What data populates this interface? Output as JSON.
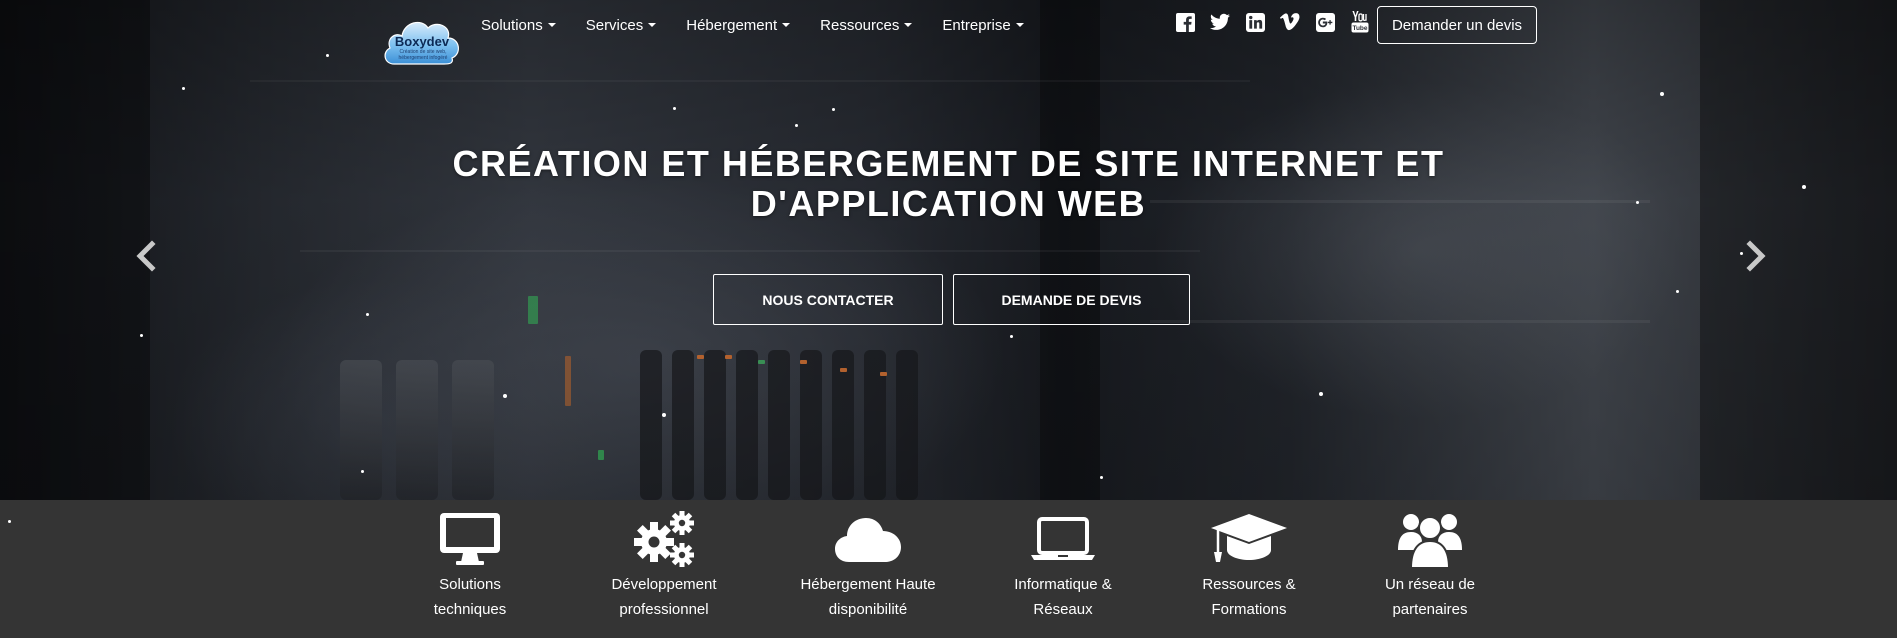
{
  "brand": {
    "name": "Boxydev",
    "tagline": "Création de site web, hébergement infogéré"
  },
  "nav": {
    "items": [
      {
        "label": "Solutions"
      },
      {
        "label": "Services"
      },
      {
        "label": "Hébergement"
      },
      {
        "label": "Ressources"
      },
      {
        "label": "Entreprise"
      }
    ],
    "socials": [
      "facebook-icon",
      "twitter-icon",
      "linkedin-icon",
      "vimeo-icon",
      "google-plus-icon",
      "youtube-icon"
    ],
    "quote_button": "Demander un devis"
  },
  "hero": {
    "headline_line1": "CRÉATION ET HÉBERGEMENT DE SITE INTERNET ET",
    "headline_line2": "D'APPLICATION WEB",
    "cta_contact": "NOUS CONTACTER",
    "cta_quote": "DEMANDE DE DEVIS"
  },
  "features": [
    {
      "icon": "monitor-icon",
      "line1": "Solutions",
      "line2": "techniques"
    },
    {
      "icon": "gears-icon",
      "line1": "Développement",
      "line2": "professionnel"
    },
    {
      "icon": "cloud-icon",
      "line1": "Hébergement Haute",
      "line2": "disponibilité"
    },
    {
      "icon": "laptop-icon",
      "line1": "Informatique &",
      "line2": "Réseaux"
    },
    {
      "icon": "graduation-cap-icon",
      "line1": "Ressources &",
      "line2": "Formations"
    },
    {
      "icon": "users-icon",
      "line1": "Un réseau de",
      "line2": "partenaires"
    }
  ],
  "colors": {
    "feature_bar": "#343434",
    "text": "#ffffff",
    "logo_cloud": "#4aa3e6"
  }
}
